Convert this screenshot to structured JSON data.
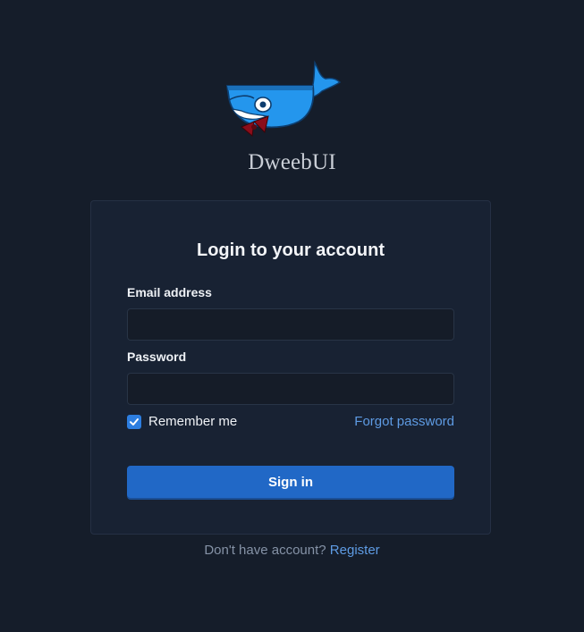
{
  "app": {
    "brand_name": "DweebUI",
    "logo_icon": "whale-with-bowtie-icon"
  },
  "login": {
    "title": "Login to your account",
    "email_label": "Email address",
    "email_value": "",
    "password_label": "Password",
    "password_value": "",
    "remember_label": "Remember me",
    "remember_checked": true,
    "forgot_label": "Forgot password",
    "signin_label": "Sign in"
  },
  "footer": {
    "prompt": "Don't have account?",
    "register_label": "Register"
  },
  "colors": {
    "background": "#151d2a",
    "card": "#182233",
    "accent": "#2168c6",
    "link": "#5e9be3",
    "whale": "#2496ed",
    "bowtie": "#8b0d1a"
  }
}
